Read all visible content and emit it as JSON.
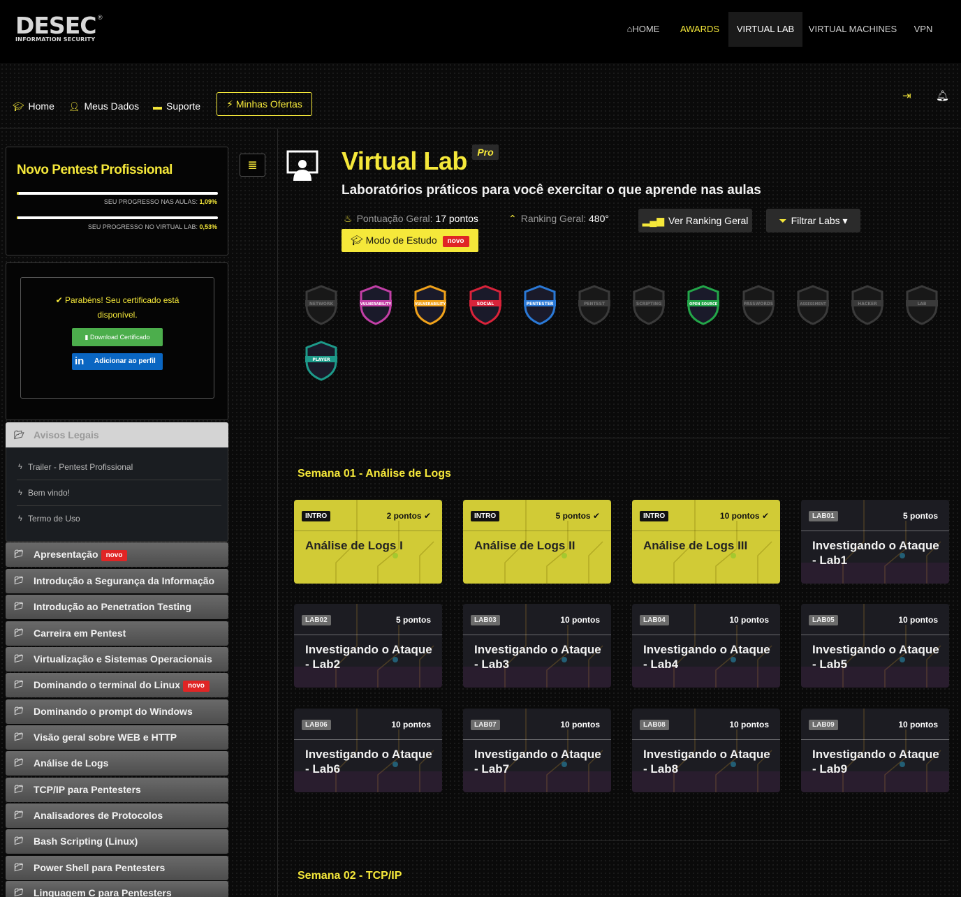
{
  "brand": {
    "name": "DESEC",
    "tagline": "INFORMATION SECURITY",
    "registered": "®"
  },
  "topnav": [
    {
      "label": "HOME",
      "icon": "home-icon"
    },
    {
      "label": "AWARDS"
    },
    {
      "label": "VIRTUAL LAB",
      "active": true
    },
    {
      "label": "VIRTUAL MACHINES"
    },
    {
      "label": "VPN"
    }
  ],
  "subnav": {
    "home": "Home",
    "my_data": "Meus Dados",
    "support": "Suporte",
    "offers": "Minhas Ofertas"
  },
  "sidebar": {
    "course_title": "Novo Pentest Profissional",
    "progress_lessons_label": "SEU PROGRESSO NAS AULAS:",
    "progress_lessons_value": "1,09%",
    "progress_lessons_fraction": 0.0109,
    "progress_lab_label": "SEU PROGRESSO NO VIRTUAL LAB:",
    "progress_lab_value": "0,53%",
    "progress_lab_fraction": 0.0053,
    "certificate_message": "Parabéns! Seu certificado está disponível.",
    "download_cert": "Download Certificado",
    "add_profile": "Adicionar ao perfil",
    "legal_header": "Avisos Legais",
    "legal_items": [
      "Trailer - Pentest Profissional",
      "Bem vindo!",
      "Termo de Uso"
    ],
    "modules": [
      "Apresentação",
      "Introdução a Segurança da Informação",
      "Introdução ao Penetration Testing",
      "Carreira em Pentest",
      "Virtualização e Sistemas Operacionais",
      "Dominando o terminal do Linux",
      "Dominando o prompt do Windows",
      "Visão geral sobre WEB e HTTP",
      "Análise de Logs",
      "TCP/IP para Pentesters",
      "Analisadores de Protocolos",
      "Bash Scripting (Linux)",
      "Power Shell para Pentesters",
      "Linguagem C para Pentesters"
    ],
    "novo_label": "novo"
  },
  "main": {
    "title": "Virtual Lab",
    "pro": "Pro",
    "subtitle": "Laboratórios práticos para você exercitar o que aprende nas aulas",
    "score_label": "Pontuação Geral:",
    "score_value": "17 pontos",
    "ranking_label": "Ranking Geral:",
    "ranking_value": "480°",
    "ranking_button": "Ver Ranking Geral",
    "filter_button": "Filtrar Labs",
    "study_mode": "Modo de Estudo",
    "novo": "novo"
  },
  "awards": [
    {
      "label": "NETWORK",
      "earned": false,
      "color": "#555555"
    },
    {
      "label": "VULNERABILITY",
      "earned": true,
      "color": "#c23fa6"
    },
    {
      "label": "VULNERABILITY",
      "earned": true,
      "color": "#f0a21a"
    },
    {
      "label": "SOCIAL",
      "earned": true,
      "color": "#d9233a"
    },
    {
      "label": "PENTESTER",
      "earned": true,
      "color": "#2a79d6"
    },
    {
      "label": "PENTEST",
      "earned": false,
      "color": "#555555"
    },
    {
      "label": "SCRIPTING",
      "earned": false,
      "color": "#555555"
    },
    {
      "label": "OPEN SOURCE",
      "earned": true,
      "color": "#23a649"
    },
    {
      "label": "PASSWORDS",
      "earned": false,
      "color": "#555555"
    },
    {
      "label": "ASSESSMENT",
      "earned": false,
      "color": "#555555"
    },
    {
      "label": "HACKER",
      "earned": false,
      "color": "#555555"
    },
    {
      "label": "LAB",
      "earned": false,
      "color": "#555555"
    },
    {
      "label": "PLAYER",
      "earned": true,
      "color": "#1d9a8a"
    }
  ],
  "weeks": [
    {
      "title": "Semana 01 - Análise de Logs",
      "labs": [
        {
          "tag": "INTRO",
          "points": "2 pontos",
          "done": true,
          "title": "Análise de Logs I"
        },
        {
          "tag": "INTRO",
          "points": "5 pontos",
          "done": true,
          "title": "Análise de Logs II"
        },
        {
          "tag": "INTRO",
          "points": "10 pontos",
          "done": true,
          "title": "Análise de Logs III"
        },
        {
          "tag": "LAB01",
          "points": "5 pontos",
          "done": false,
          "title": "Investigando o Ataque - Lab1"
        },
        {
          "tag": "LAB02",
          "points": "5 pontos",
          "done": false,
          "title": "Investigando o Ataque - Lab2"
        },
        {
          "tag": "LAB03",
          "points": "10 pontos",
          "done": false,
          "title": "Investigando o Ataque - Lab3"
        },
        {
          "tag": "LAB04",
          "points": "10 pontos",
          "done": false,
          "title": "Investigando o Ataque - Lab4"
        },
        {
          "tag": "LAB05",
          "points": "10 pontos",
          "done": false,
          "title": "Investigando o Ataque - Lab5"
        },
        {
          "tag": "LAB06",
          "points": "10 pontos",
          "done": false,
          "title": "Investigando o Ataque - Lab6"
        },
        {
          "tag": "LAB07",
          "points": "10 pontos",
          "done": false,
          "title": "Investigando o Ataque - Lab7"
        },
        {
          "tag": "LAB08",
          "points": "10 pontos",
          "done": false,
          "title": "Investigando o Ataque - Lab8"
        },
        {
          "tag": "LAB09",
          "points": "10 pontos",
          "done": false,
          "title": "Investigando o Ataque - Lab9"
        }
      ]
    },
    {
      "title": "Semana 02 - TCP/IP",
      "labs": []
    }
  ],
  "colors": {
    "accent": "#f5e83a",
    "novo": "#e02525",
    "download": "#4cae4c",
    "linkedin": "#0a66c2"
  }
}
